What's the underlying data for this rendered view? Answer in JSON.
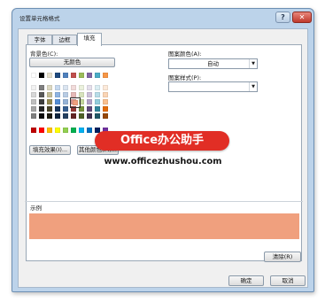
{
  "window": {
    "title": "设置单元格格式",
    "help_label": "?",
    "close_label": "✕"
  },
  "tabs": [
    {
      "label": "字体",
      "active": false
    },
    {
      "label": "边框",
      "active": false
    },
    {
      "label": "填充",
      "active": true
    }
  ],
  "background_color": {
    "label": "背景色(C):",
    "no_color_label": "无颜色",
    "selected_color": "#f0a07e",
    "theme_rows": [
      [
        "#ffffff",
        "#000000",
        "#e6e0cd",
        "#1f497d",
        "#4f81bd",
        "#c0504d",
        "#9bbb59",
        "#8064a2",
        "#4bacc6",
        "#f79646"
      ],
      [
        "#f2f2f2",
        "#7f7f7f",
        "#ddd9c3",
        "#c6d9f0",
        "#dbe5f1",
        "#f2dcdb",
        "#ebf1dd",
        "#e5e0ec",
        "#dbeef3",
        "#fdeada"
      ],
      [
        "#d8d8d8",
        "#595959",
        "#c4bd97",
        "#8db3e2",
        "#b8cce4",
        "#e5b9b7",
        "#d7e3bc",
        "#ccc1d9",
        "#b7dde8",
        "#fbd5b5"
      ],
      [
        "#bfbfbf",
        "#3f3f3f",
        "#938953",
        "#548dd4",
        "#95b3d7",
        "#d99694",
        "#c3d69b",
        "#b2a2c7",
        "#92cddc",
        "#fac08f"
      ],
      [
        "#a5a5a5",
        "#262626",
        "#494429",
        "#17365d",
        "#366092",
        "#953734",
        "#76923c",
        "#5f497a",
        "#31859b",
        "#e36c09"
      ],
      [
        "#7f7f7f",
        "#0c0c0c",
        "#1d1b10",
        "#0f243e",
        "#244061",
        "#632423",
        "#4f6128",
        "#3f3151",
        "#205867",
        "#974806"
      ]
    ],
    "standard_row": [
      "#c00000",
      "#ff0000",
      "#ffc000",
      "#ffff00",
      "#92d050",
      "#00b050",
      "#00b0f0",
      "#0070c0",
      "#002060",
      "#7030a0"
    ]
  },
  "buttons": {
    "fill_effects": "填充效果(I)...",
    "more_colors": "其他颜色(M)...",
    "clear": "清除(R)",
    "ok": "确定",
    "cancel": "取消"
  },
  "pattern_color": {
    "label": "图案颜色(A):",
    "value": "自动"
  },
  "pattern_style": {
    "label": "图案样式(P):",
    "value": ""
  },
  "watermark": {
    "brand": "Office办公助手",
    "url": "www.officezhushou.com"
  },
  "sample": {
    "label": "示例",
    "color": "#f0a07e"
  }
}
